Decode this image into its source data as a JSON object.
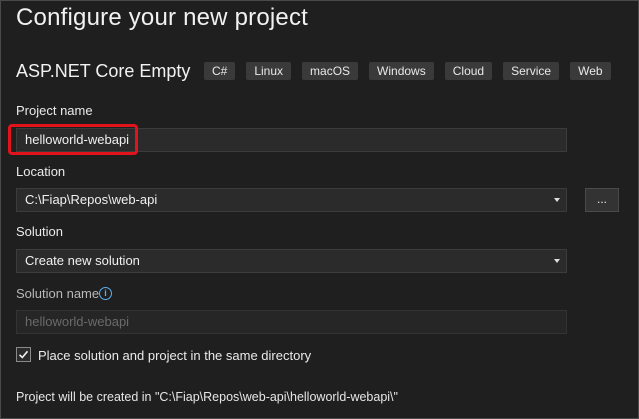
{
  "header": {
    "title": "Configure your new project"
  },
  "template": {
    "name": "ASP.NET Core Empty",
    "tags": [
      "C#",
      "Linux",
      "macOS",
      "Windows",
      "Cloud",
      "Service",
      "Web"
    ]
  },
  "project_name": {
    "label": "Project name",
    "value": "helloworld-webapi"
  },
  "location": {
    "label": "Location",
    "value": "C:\\Fiap\\Repos\\web-api",
    "browse_label": "..."
  },
  "solution": {
    "label": "Solution",
    "value": "Create new solution"
  },
  "solution_name": {
    "label": "Solution name",
    "value": "helloworld-webapi"
  },
  "same_directory": {
    "label": "Place solution and project in the same directory",
    "checked": true
  },
  "footer": {
    "note": "Project will be created in \"C:\\Fiap\\Repos\\web-api\\helloworld-webapi\\\""
  },
  "colors": {
    "highlight": "#e1141c",
    "info": "#5ab0f0",
    "background": "#1f1f1f"
  },
  "icons": {
    "info": "info-icon",
    "check": "checkmark-icon",
    "dropdown": "chevron-down-icon"
  }
}
